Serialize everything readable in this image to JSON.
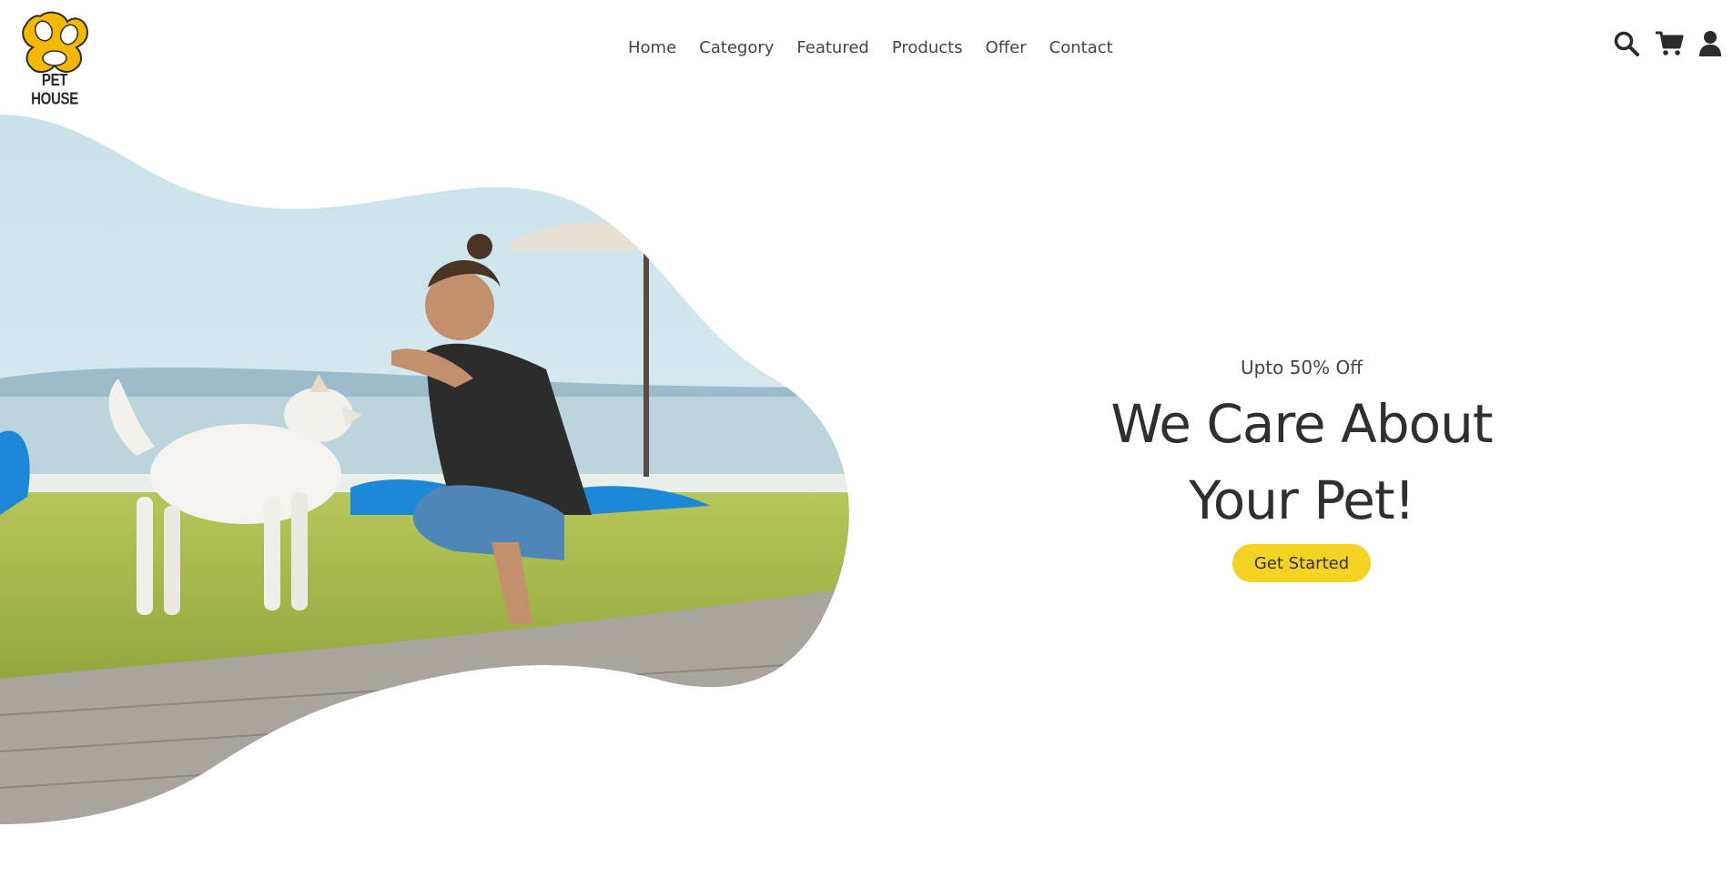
{
  "brand": {
    "name": "PET HOUSE",
    "primary_color": "#f5b800",
    "accent_color": "#f5d322",
    "text_color": "#2f2f2f"
  },
  "nav": {
    "items": [
      {
        "label": "Home"
      },
      {
        "label": "Category"
      },
      {
        "label": "Featured"
      },
      {
        "label": "Products"
      },
      {
        "label": "Offer"
      },
      {
        "label": "Contact"
      }
    ]
  },
  "header_icons": [
    "search-icon",
    "cart-icon",
    "user-icon"
  ],
  "hero": {
    "subtitle": "Upto 50% Off",
    "title_line1": "We Care About",
    "title_line2": "Your Pet!",
    "cta_label": "Get Started",
    "image_alt": "man feeding a white dog on grass by the sea"
  }
}
